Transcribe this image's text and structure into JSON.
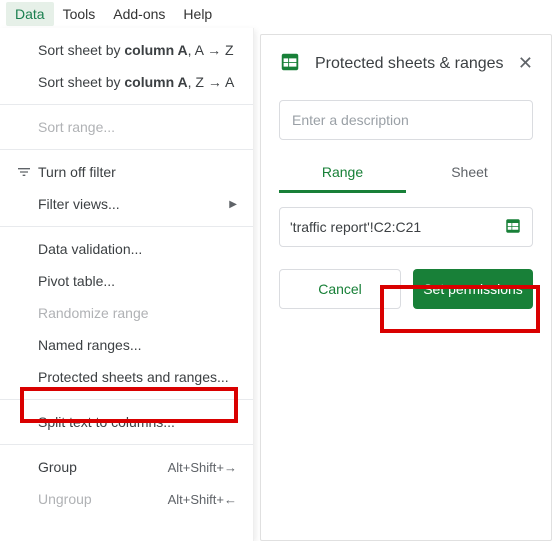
{
  "menubar": {
    "data": "Data",
    "tools": "Tools",
    "addons": "Add-ons",
    "help": "Help"
  },
  "menu": {
    "sort_az_prefix": "Sort sheet by ",
    "sort_col": "column A",
    "sort_az_suffix": ", A → Z",
    "sort_za_suffix": ", Z → A",
    "sort_range": "Sort range...",
    "turn_off_filter": "Turn off filter",
    "filter_views": "Filter views...",
    "data_validation": "Data validation...",
    "pivot_table": "Pivot table...",
    "randomize": "Randomize range",
    "named_ranges": "Named ranges...",
    "protected": "Protected sheets and ranges...",
    "split_text": "Split text to columns...",
    "group": "Group",
    "group_sc": "Alt+Shift+→",
    "ungroup": "Ungroup",
    "ungroup_sc": "Alt+Shift+←"
  },
  "panel": {
    "title": "Protected sheets & ranges",
    "desc_placeholder": "Enter a description",
    "tab_range": "Range",
    "tab_sheet": "Sheet",
    "range_value": "'traffic report'!C2:C21",
    "cancel": "Cancel",
    "set_permissions": "Set permissions"
  }
}
